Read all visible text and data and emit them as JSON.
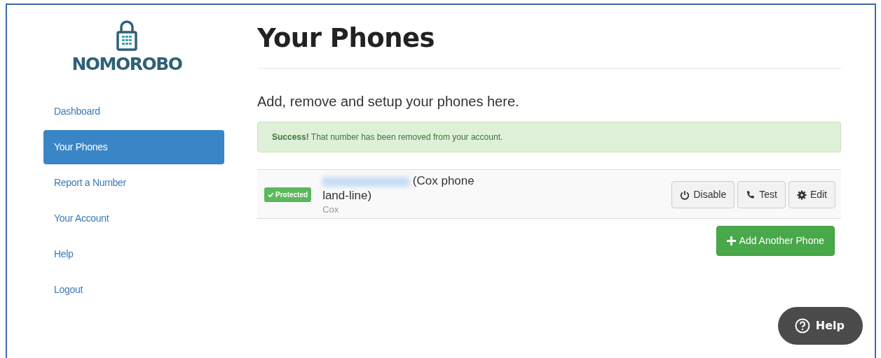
{
  "logo": {
    "text": "NOMOROBO"
  },
  "sidebar": {
    "items": [
      {
        "label": "Dashboard",
        "selected": false
      },
      {
        "label": "Your Phones",
        "selected": true
      },
      {
        "label": "Report a Number",
        "selected": false
      },
      {
        "label": "Your Account",
        "selected": false
      },
      {
        "label": "Help",
        "selected": false
      },
      {
        "label": "Logout",
        "selected": false
      }
    ]
  },
  "page": {
    "title": "Your Phones",
    "subtitle": "Add, remove and setup your phones here."
  },
  "alert": {
    "text": "**Success!** That number has been removed from your account."
  },
  "phones": [
    {
      "status": "Protected",
      "description": "(Cox phone land-line)",
      "carrier": "Cox",
      "buttons": [
        {
          "kind": "power",
          "label": "Disable"
        },
        {
          "kind": "phone",
          "label": "Test"
        },
        {
          "kind": "gear",
          "label": "Edit"
        }
      ]
    }
  ],
  "add_button": {
    "label": "Add Another Phone"
  },
  "help_button": {
    "label": "Help"
  }
}
